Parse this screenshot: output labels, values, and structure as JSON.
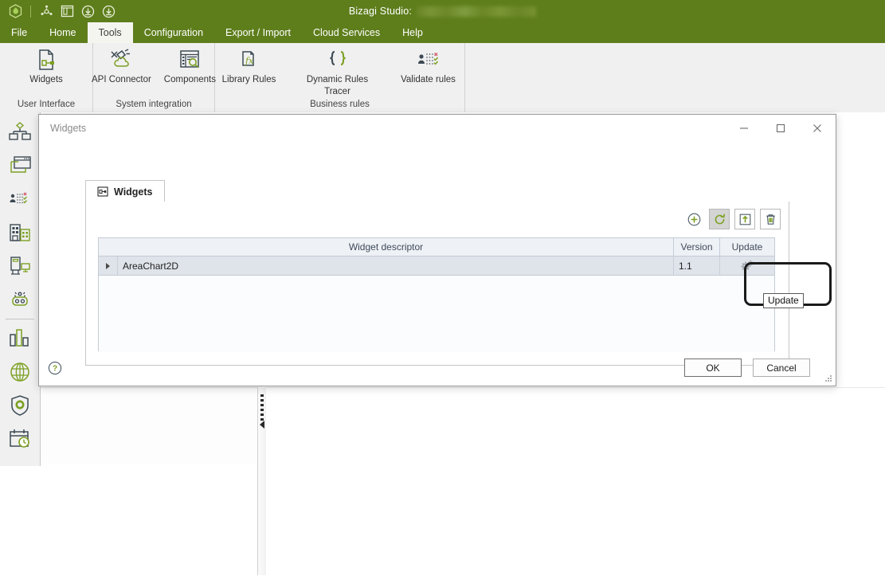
{
  "app": {
    "title_label": "Bizagi Studio:",
    "accent_green": "#5E7E1C",
    "icon_green": "#7CA023",
    "icon_dark": "#3C4A54"
  },
  "quick_access": [
    {
      "name": "bizagi-logo-icon"
    },
    {
      "name": "rotate-icon"
    },
    {
      "name": "window-icon"
    },
    {
      "name": "download-icon"
    },
    {
      "name": "download-alt-icon"
    }
  ],
  "menubar": {
    "items": [
      {
        "label": "File",
        "active": false
      },
      {
        "label": "Home",
        "active": false
      },
      {
        "label": "Tools",
        "active": true
      },
      {
        "label": "Configuration",
        "active": false
      },
      {
        "label": "Export / Import",
        "active": false
      },
      {
        "label": "Cloud Services",
        "active": false
      },
      {
        "label": "Help",
        "active": false
      }
    ]
  },
  "ribbon": {
    "groups": [
      {
        "title": "User Interface",
        "buttons": [
          {
            "label": "Widgets",
            "icon": "widget-page-icon"
          }
        ]
      },
      {
        "title": "System integration",
        "buttons": [
          {
            "label": "API Connector",
            "icon": "api-connector-icon"
          },
          {
            "label": "Components",
            "icon": "components-icon"
          }
        ]
      },
      {
        "title": "Business rules",
        "buttons": [
          {
            "label": "Library Rules",
            "icon": "library-rules-icon"
          },
          {
            "label": "Dynamic Rules\nTracer",
            "icon": "dynamic-rules-icon"
          },
          {
            "label": "Validate rules",
            "icon": "validate-rules-icon"
          }
        ]
      }
    ],
    "dynamic_rules_line1": "Dynamic Rules",
    "dynamic_rules_line2": "Tracer"
  },
  "sidebar": {
    "items": [
      {
        "name": "process-model-icon",
        "label": "Process model"
      },
      {
        "name": "forms-icon",
        "label": "Forms"
      },
      {
        "name": "business-rules-icon",
        "label": "Business rules"
      },
      {
        "name": "organization-icon",
        "label": "Organization"
      },
      {
        "name": "devices-icon",
        "label": "Devices"
      },
      {
        "name": "bot-icon",
        "label": "Bots"
      },
      {
        "name": "analytics-icon",
        "label": "Analytics"
      },
      {
        "name": "web-icon",
        "label": "Web"
      },
      {
        "name": "security-icon",
        "label": "Security"
      },
      {
        "name": "scheduler-icon",
        "label": "Scheduler"
      }
    ]
  },
  "dialog": {
    "title": "Widgets",
    "window_buttons": [
      {
        "name": "minimize-button",
        "glyph": "minimize"
      },
      {
        "name": "maximize-button",
        "glyph": "maximize"
      },
      {
        "name": "close-button",
        "glyph": "close"
      }
    ],
    "tab": {
      "label": "Widgets",
      "icon": "widget-tab-icon"
    },
    "toolbar": [
      {
        "name": "add-widget-button",
        "icon": "plus-circle-icon",
        "state": "normal"
      },
      {
        "name": "update-widget-button",
        "icon": "refresh-icon",
        "state": "hover"
      },
      {
        "name": "export-widget-button",
        "icon": "export-up-icon",
        "state": "normal"
      },
      {
        "name": "delete-widget-button",
        "icon": "trash-icon",
        "state": "normal"
      }
    ],
    "tooltip": "Update",
    "grid": {
      "columns": [
        "Widget descriptor",
        "Version",
        "Update"
      ],
      "rows": [
        {
          "descriptor": "AreaChart2D",
          "version": "1.1",
          "update_icon": "gears-icon"
        }
      ]
    },
    "help_label": "?",
    "buttons": {
      "ok": "OK",
      "cancel": "Cancel"
    }
  }
}
